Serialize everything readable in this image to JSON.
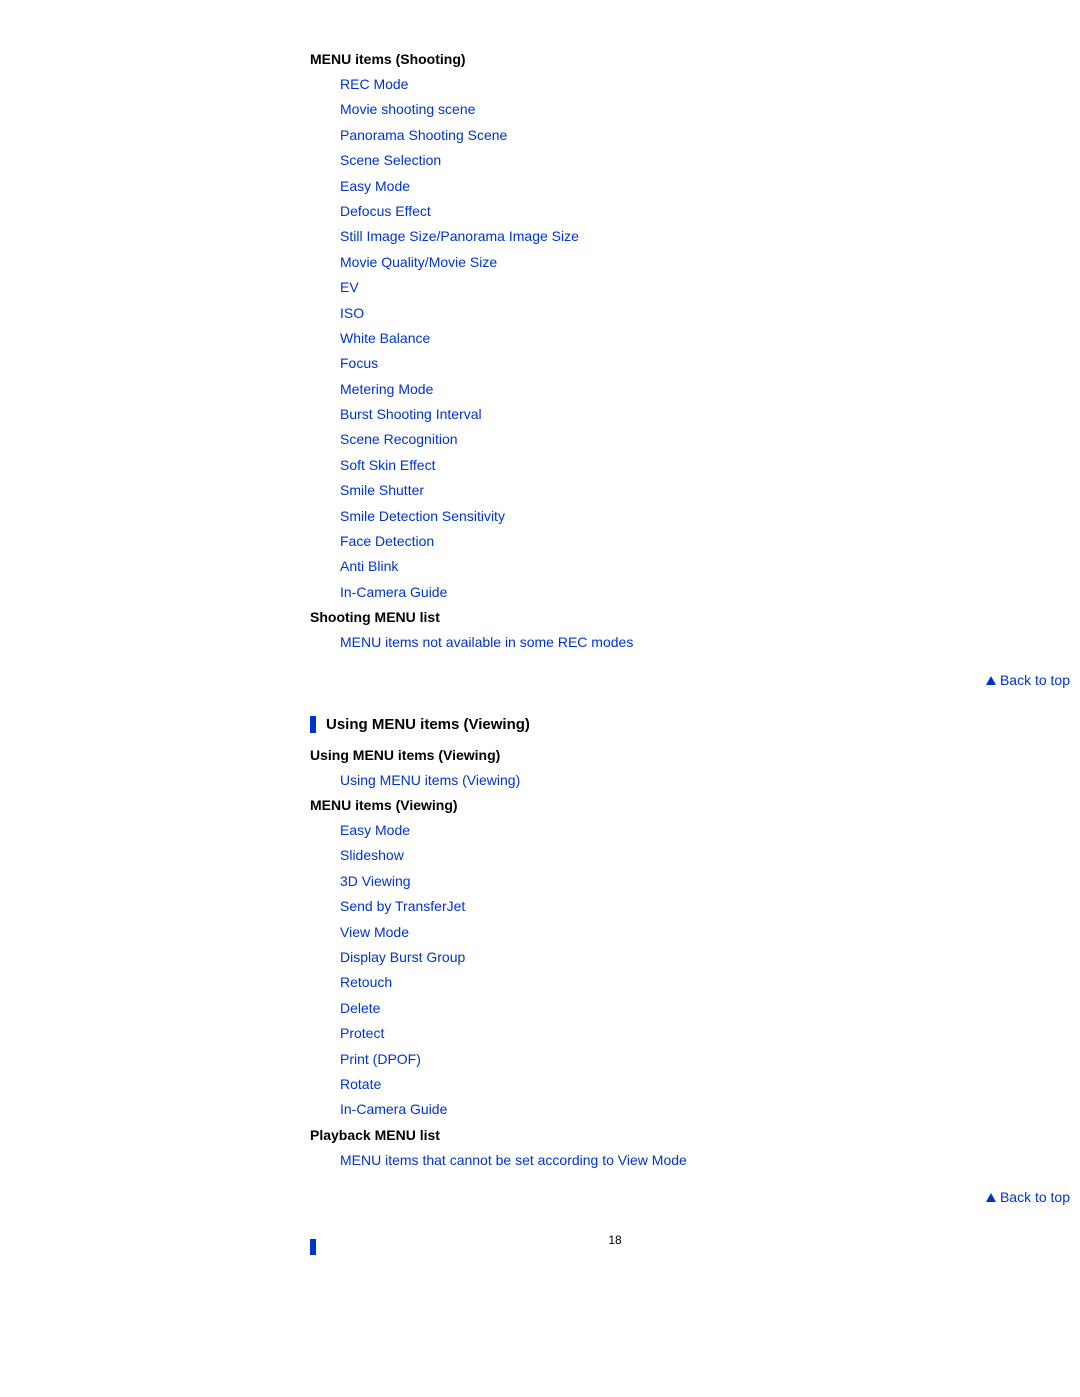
{
  "sections": {
    "shooting": {
      "heading": "MENU items (Shooting)",
      "items": [
        "REC Mode",
        "Movie shooting scene",
        "Panorama Shooting Scene",
        "Scene Selection",
        "Easy Mode",
        "Defocus Effect",
        "Still Image Size/Panorama Image Size",
        "Movie Quality/Movie Size",
        "EV",
        "ISO",
        "White Balance",
        "Focus",
        "Metering Mode",
        "Burst Shooting Interval",
        "Scene Recognition",
        "Soft Skin Effect",
        "Smile Shutter",
        "Smile Detection Sensitivity",
        "Face Detection",
        "Anti Blink",
        "In-Camera Guide"
      ]
    },
    "shooting_list": {
      "heading": "Shooting MENU list",
      "items": [
        "MENU items not available in some REC modes"
      ]
    },
    "viewing_section_title": "Using MENU items (Viewing)",
    "using_viewing": {
      "heading": "Using MENU items (Viewing)",
      "items": [
        "Using MENU items (Viewing)"
      ]
    },
    "viewing": {
      "heading": "MENU items (Viewing)",
      "items": [
        "Easy Mode",
        "Slideshow",
        "3D Viewing",
        "Send by TransferJet",
        "View Mode",
        "Display Burst Group",
        "Retouch",
        "Delete",
        "Protect",
        "Print (DPOF)",
        "Rotate",
        "In-Camera Guide"
      ]
    },
    "playback_list": {
      "heading": "Playback MENU list",
      "items": [
        "MENU items that cannot be set according to View Mode"
      ]
    }
  },
  "back_to_top": "Back to top",
  "page_number": "18"
}
